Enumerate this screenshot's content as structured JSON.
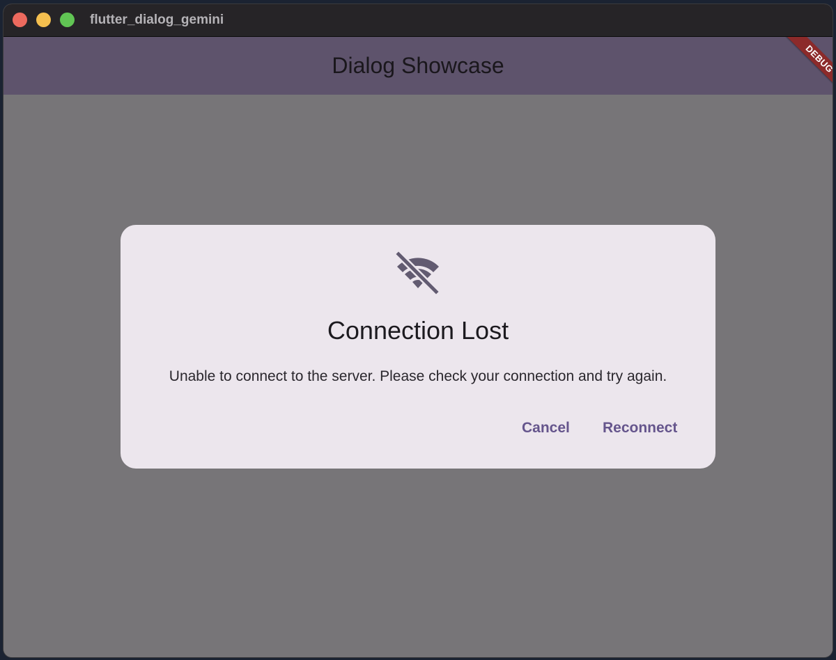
{
  "window": {
    "title": "flutter_dialog_gemini"
  },
  "appbar": {
    "title": "Dialog Showcase",
    "debug_label": "DEBUG"
  },
  "dialog": {
    "icon": "wifi-off-icon",
    "title": "Connection Lost",
    "message": "Unable to connect to the server. Please check your connection and try again.",
    "cancel_label": "Cancel",
    "reconnect_label": "Reconnect"
  },
  "colors": {
    "appbar": "#5e536c",
    "dialog_bg": "#ece6ed",
    "scrim": "#777578",
    "accent": "#65558c",
    "debug_banner": "#8c2a2a"
  }
}
